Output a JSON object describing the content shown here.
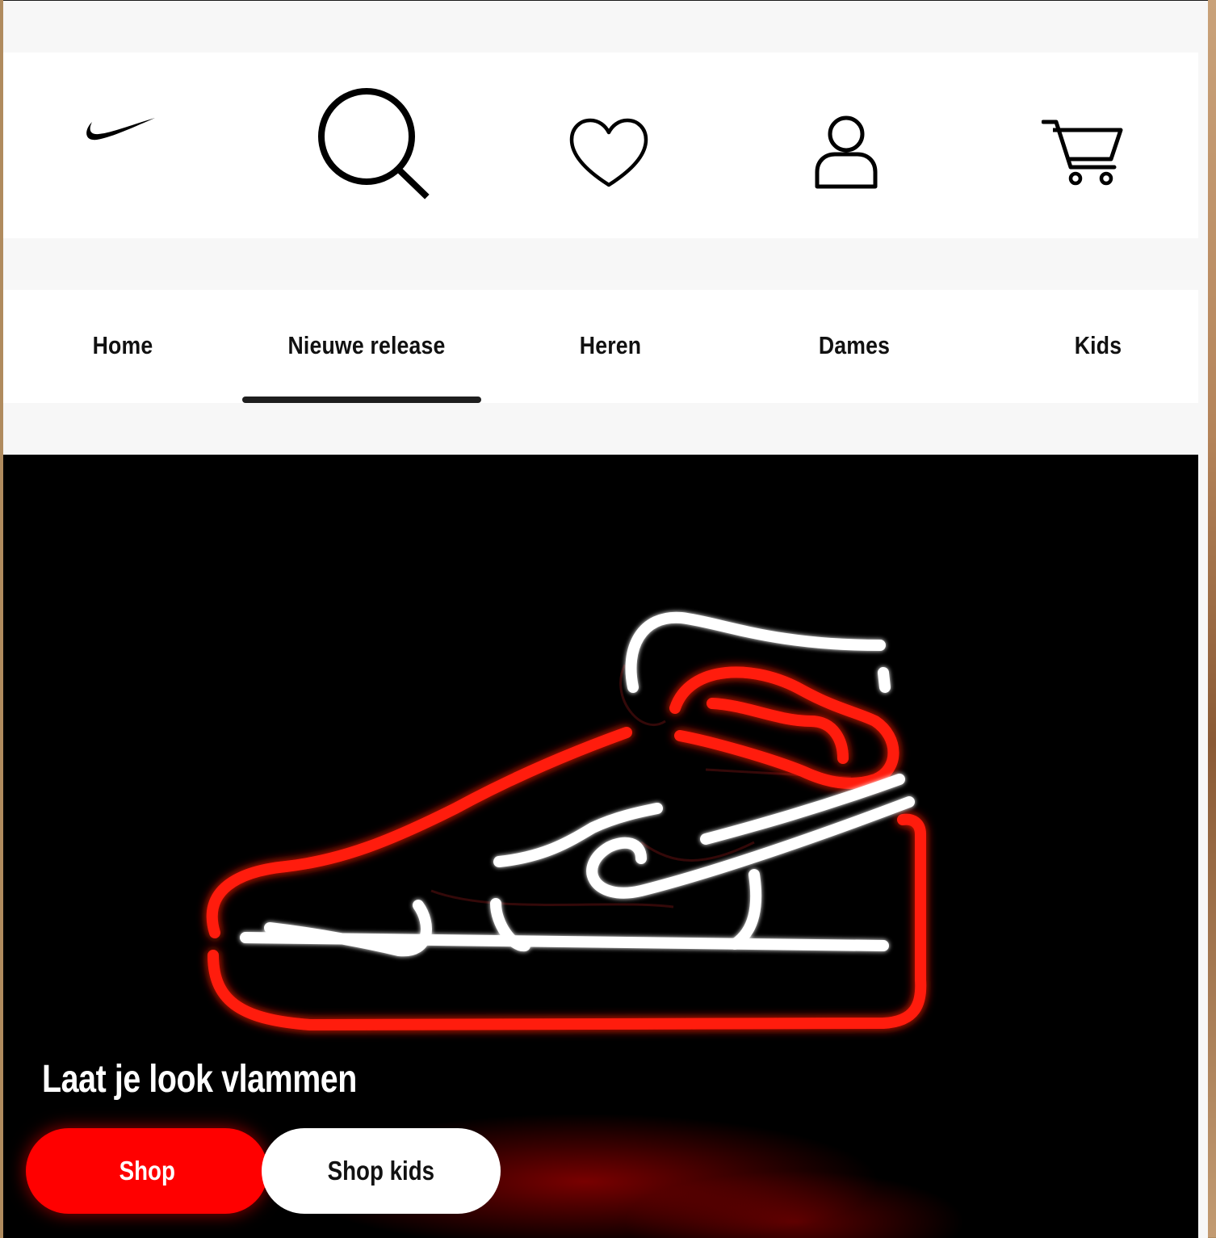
{
  "header": {
    "logo_icon": "nike-swoosh-icon",
    "icons": [
      "search-icon",
      "heart-icon",
      "user-icon",
      "cart-icon"
    ]
  },
  "nav": {
    "items": [
      "Home",
      "Nieuwe release",
      "Heren",
      "Dames",
      "Kids"
    ],
    "active_index": 1
  },
  "hero": {
    "image": "neon-sneaker-icon",
    "title": "Laat je look vlammen",
    "primary_button": "Shop",
    "secondary_button": "Shop kids"
  },
  "colors": {
    "accent": "#ff0000",
    "text": "#111111",
    "background": "#f7f7f7"
  }
}
